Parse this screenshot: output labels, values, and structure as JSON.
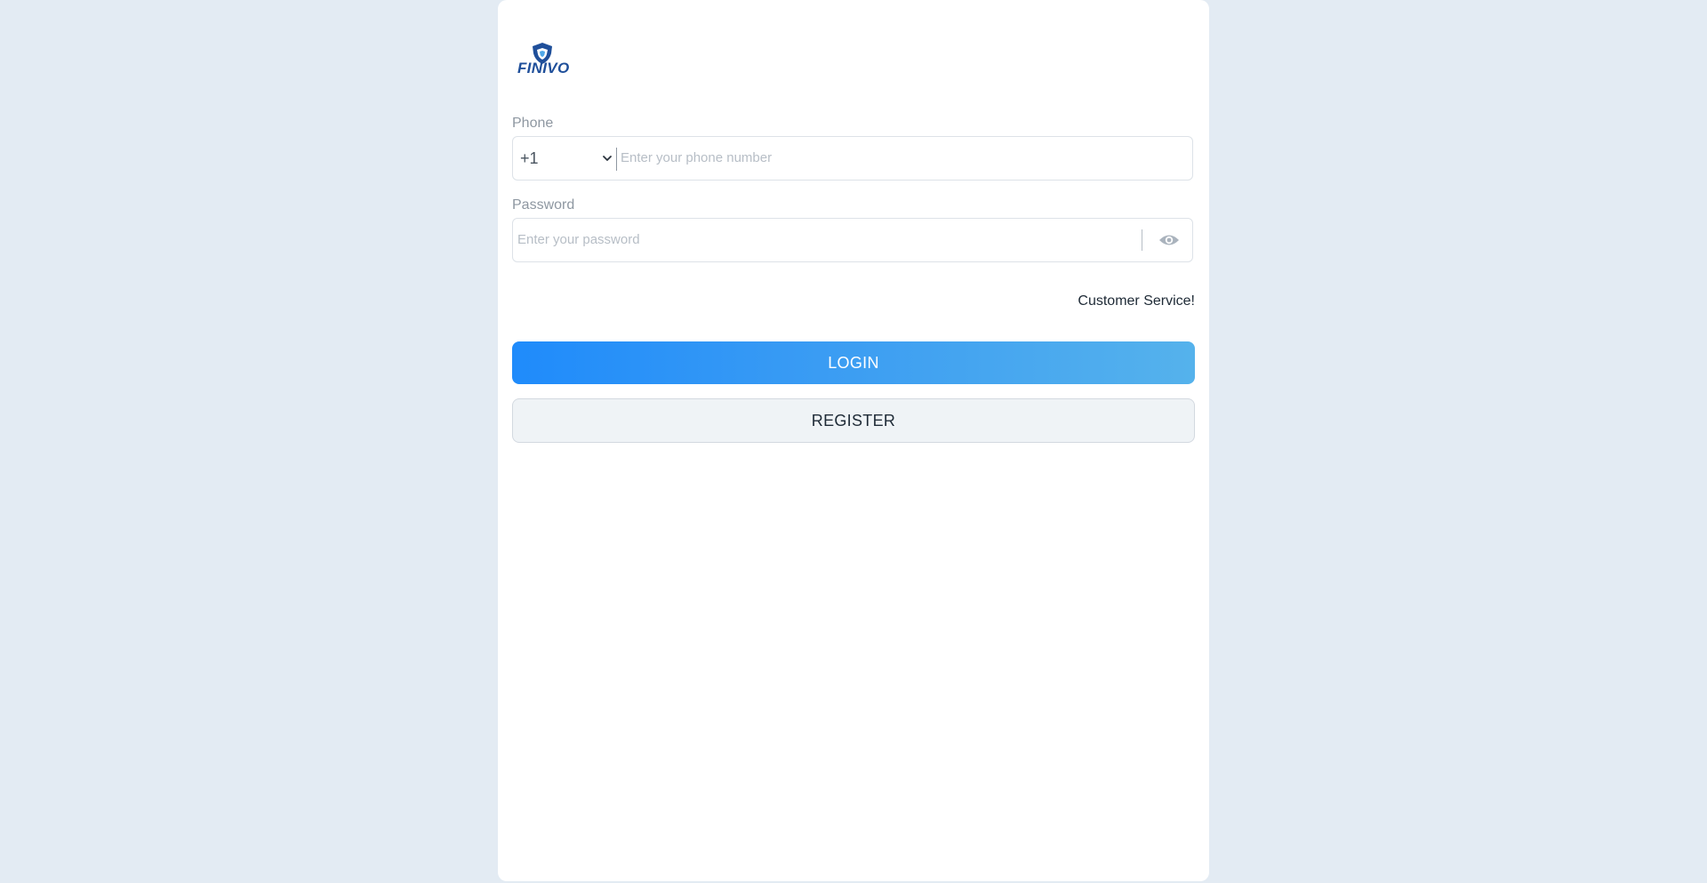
{
  "brand": {
    "logo_text": "FINIVO",
    "logo_icon": "shield-icon",
    "primary_color": "#1f4f9a"
  },
  "form": {
    "phone": {
      "label": "Phone",
      "country_code": "+1",
      "placeholder": "Enter your phone number"
    },
    "password": {
      "label": "Password",
      "placeholder": "Enter your password",
      "toggle_icon": "eye-icon"
    },
    "customer_service_label": "Customer Service!",
    "login_label": "LOGIN",
    "register_label": "REGISTER"
  },
  "colors": {
    "background": "#e3ebf3",
    "login_gradient_start": "#1f8bfb",
    "login_gradient_end": "#55b2ec",
    "register_bg": "#eff3f6"
  }
}
